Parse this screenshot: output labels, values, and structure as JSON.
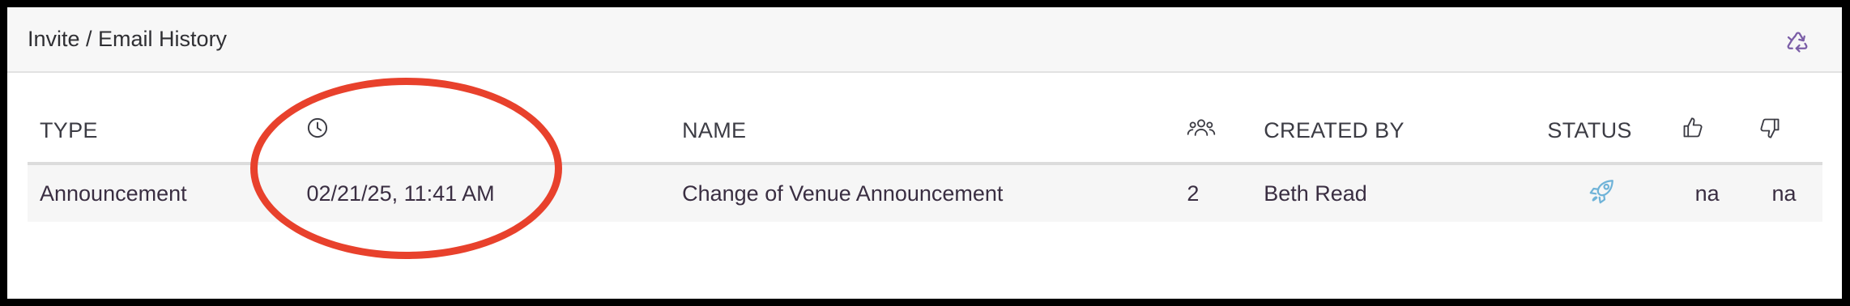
{
  "header": {
    "title": "Invite / Email History",
    "refresh_icon": "recycle-icon",
    "refresh_icon_color": "#7b5ea7"
  },
  "table": {
    "columns": [
      {
        "key": "type",
        "label": "TYPE"
      },
      {
        "key": "sent",
        "label": "",
        "icon": "clock-icon"
      },
      {
        "key": "name",
        "label": "NAME"
      },
      {
        "key": "recipients",
        "label": "",
        "icon": "people-icon"
      },
      {
        "key": "created_by",
        "label": "CREATED BY"
      },
      {
        "key": "status",
        "label": "STATUS"
      },
      {
        "key": "likes",
        "label": "",
        "icon": "thumbs-up-icon"
      },
      {
        "key": "dislikes",
        "label": "",
        "icon": "thumbs-down-icon"
      }
    ],
    "rows": [
      {
        "type": "Announcement",
        "sent": "02/21/25, 11:41 AM",
        "name": "Change of Venue Announcement",
        "recipients": "2",
        "created_by": "Beth Read",
        "status_icon": "rocket-icon",
        "status_color": "#6fb3d8",
        "likes": "na",
        "dislikes": "na"
      }
    ]
  },
  "annotation": {
    "shape": "ellipse",
    "color": "#e8412c"
  }
}
